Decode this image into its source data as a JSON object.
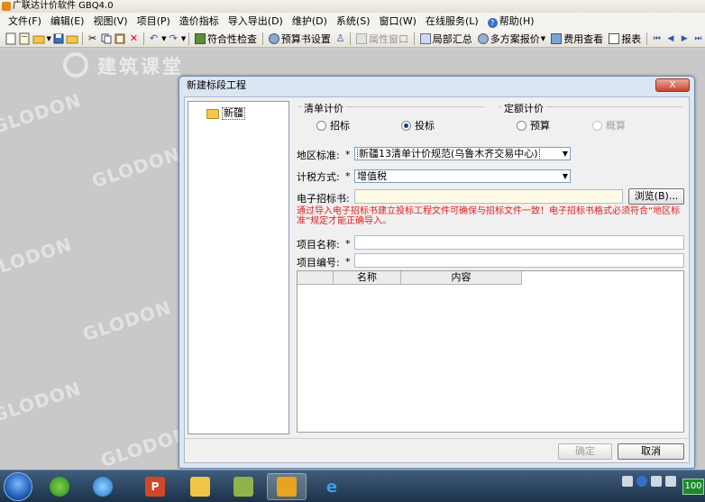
{
  "app": {
    "title": "广联达计价软件 GBQ4.0"
  },
  "menu": [
    "文件(F)",
    "编辑(E)",
    "视图(V)",
    "项目(P)",
    "造价指标",
    "导入导出(D)",
    "维护(D)",
    "系统(S)",
    "窗口(W)",
    "在线服务(L)"
  ],
  "help_label": "帮助(H)",
  "toolbar": {
    "compliance_check": "符合性检查",
    "budget_settings": "预算书设置",
    "property_window": "属性窗口",
    "partial_summary": "局部汇总",
    "multi_plan_quote": "多方案报价",
    "cost_view": "费用查看",
    "report": "报表"
  },
  "workspace": {
    "brand_text": "建筑课堂"
  },
  "dialog": {
    "title": "新建标段工程",
    "close_label": "X",
    "tree": {
      "root_label": "新疆"
    },
    "bill_group": {
      "title": "清单计价",
      "option_bid_invite": "招标",
      "option_bid_submit": "投标",
      "selected": "投标"
    },
    "quota_group": {
      "title": "定额计价",
      "option_budget": "预算",
      "option_estimate": "概算"
    },
    "region": {
      "label": "地区标准:",
      "value": "新疆13清单计价规范(乌鲁木齐交易中心)"
    },
    "tax": {
      "label": "计税方式:",
      "value": "增值税"
    },
    "tender_file": {
      "label": "电子招标书:",
      "value": "",
      "browse_label": "浏览(B)..."
    },
    "hint": "通过导入电子招标书建立投标工程文件可确保与招标文件一致！电子招标书格式必须符合“地区标准”规定才能正确导入。",
    "project_name": {
      "label": "项目名称:",
      "value": ""
    },
    "project_code": {
      "label": "项目编号:",
      "value": ""
    },
    "grid": {
      "columns": [
        "名称",
        "内容"
      ]
    },
    "ok_label": "确定",
    "cancel_label": "取消"
  },
  "taskbar": {
    "battery_label": "100"
  }
}
